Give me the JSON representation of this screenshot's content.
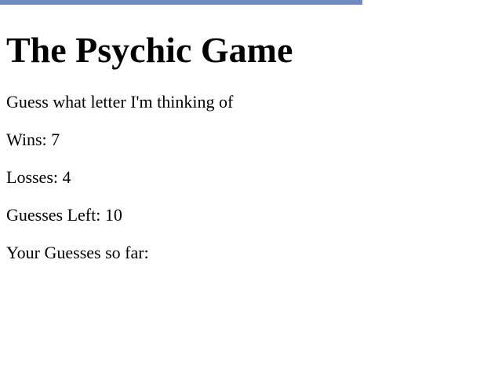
{
  "accent_color": "#6f8bc2",
  "game": {
    "title": "The Psychic Game",
    "instructions": "Guess what letter I'm thinking of",
    "wins_label": "Wins: ",
    "wins": "7",
    "losses_label": "Losses: ",
    "losses": "4",
    "guesses_left_label": "Guesses Left: ",
    "guesses_left": "10",
    "guesses_so_far_label": "Your Guesses so far: ",
    "guesses_so_far": ""
  }
}
